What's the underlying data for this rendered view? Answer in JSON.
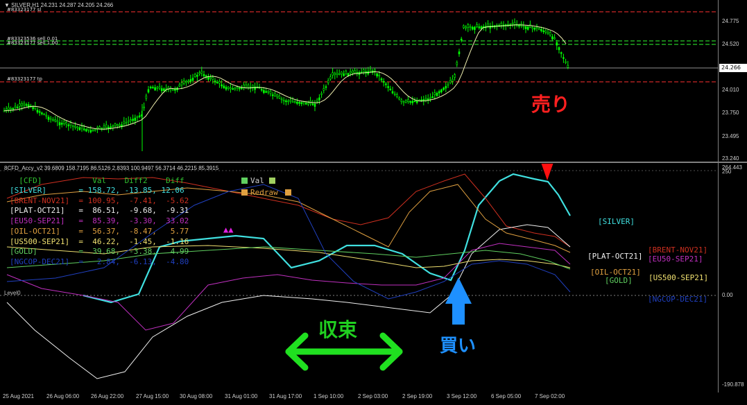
{
  "main_chart": {
    "title": "SILVER,H1 24.231 24.287 24.205 24.266",
    "current_price": "24.266",
    "price_ticks": [
      "24.775",
      "24.520",
      "24.266",
      "24.010",
      "23.750",
      "23.495",
      "23.240"
    ],
    "orders": [
      "#83323177 sl",
      "#83323536 sell 0.01",
      "#83323177 sell 1.00",
      "#83323177 tp"
    ],
    "colors": {
      "bull": "#00ff00",
      "bear": "#00ff00",
      "ma": "#f0f0b0",
      "sl": "#ff3030",
      "order": "#30ff30"
    }
  },
  "indicator": {
    "title": "8CFD_Accy_v2 39.6809 158.7195 86.5126 2.8393 100.9497 56.3714 46.2215 85.3915",
    "top_value": "264.443",
    "axis_top": "250",
    "axis_zero": "0.00",
    "axis_bottom": "-190.878",
    "zero_label": "Level0",
    "table": {
      "header": "  [CFD]           Val    Diff2    Diff",
      "val_label": "Val",
      "redraw_label": "Redraw",
      "rows": [
        {
          "text": "[SILVER]       = 158.72, -13.85, 12.06",
          "color": "#40e0e0"
        },
        {
          "text": "[BRENT-NOV21]  = 100.95,  -7.41,  -5.62",
          "color": "#d03020"
        },
        {
          "text": "[PLAT-OCT21]   =  86.51,  -9.68,  -9.31",
          "color": "#f0f0f0"
        },
        {
          "text": "[EU50-SEP21]   =  85.39,  -3.30,  33.02",
          "color": "#c030c0"
        },
        {
          "text": "[OIL-OCT21]    =  56.37,  -8.47,   5.77",
          "color": "#e0a040"
        },
        {
          "text": "[US500-SEP21]  =  46.22,  -1.45,  -1.16",
          "color": "#f0e070"
        },
        {
          "text": "[GOLD]         =  39.68,  -3.38,   4.99",
          "color": "#60d060"
        },
        {
          "text": "[NGCOP-DEC21]  =   2.84,  -6.13,  -4.80",
          "color": "#2040c0"
        }
      ]
    },
    "series_labels": [
      {
        "name": "[SILVER]",
        "color": "#40e0e0"
      },
      {
        "name": "[BRENT-NOV21]",
        "color": "#d03020"
      },
      {
        "name": "[PLAT-OCT21]",
        "color": "#f0f0f0"
      },
      {
        "name": "[EU50-SEP21]",
        "color": "#c030c0"
      },
      {
        "name": "[OIL-OCT21]",
        "color": "#e0a040"
      },
      {
        "name": "[GOLD]",
        "color": "#60d060"
      },
      {
        "name": "[US500-SEP21]",
        "color": "#f0e070"
      },
      {
        "name": "[NGCOP-DEC21]",
        "color": "#2040c0"
      }
    ]
  },
  "time_labels": [
    "25 Aug 2021",
    "26 Aug 06:00",
    "26 Aug 22:00",
    "27 Aug 15:00",
    "30 Aug 08:00",
    "31 Aug 01:00",
    "31 Aug 17:00",
    "1 Sep 10:00",
    "2 Sep 03:00",
    "2 Sep 19:00",
    "3 Sep 12:00",
    "6 Sep 05:00",
    "7 Sep 02:00"
  ],
  "annotations": {
    "sell": "売り",
    "buy": "買い",
    "converge": "収束"
  }
}
